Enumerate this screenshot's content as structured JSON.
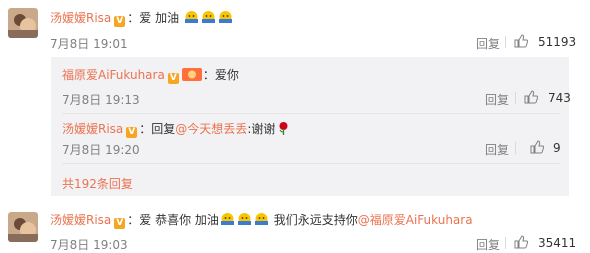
{
  "comment1": {
    "username": "汤嫒嫒Risa",
    "text": "：爱  加油",
    "time": "7月8日 19:01",
    "reply_label": "回复",
    "likes": "51193"
  },
  "replies": [
    {
      "username": "福原爱AiFukuhara",
      "text": "：爱你",
      "time": "7月8日 19:13",
      "reply_label": "回复",
      "likes": "743"
    },
    {
      "username": "汤嫒嫒Risa",
      "prefix": "：回复",
      "mention": "@今天想丢丢",
      "text": ":谢谢",
      "time": "7月8日 19:20",
      "reply_label": "回复",
      "likes": "9"
    }
  ],
  "more_replies": "共192条回复",
  "comment2": {
    "username": "汤嫒嫒Risa",
    "text_before": "：爱 恭喜你  加油",
    "text_after": " 我们永远支持你",
    "mention": "@福原爱AiFukuhara",
    "time": "7月8日 19:03",
    "reply_label": "回复",
    "likes": "35411"
  },
  "colors": {
    "username": "#eb7350",
    "verified": "#f5a623",
    "sub_bg": "#f2f2f5"
  }
}
